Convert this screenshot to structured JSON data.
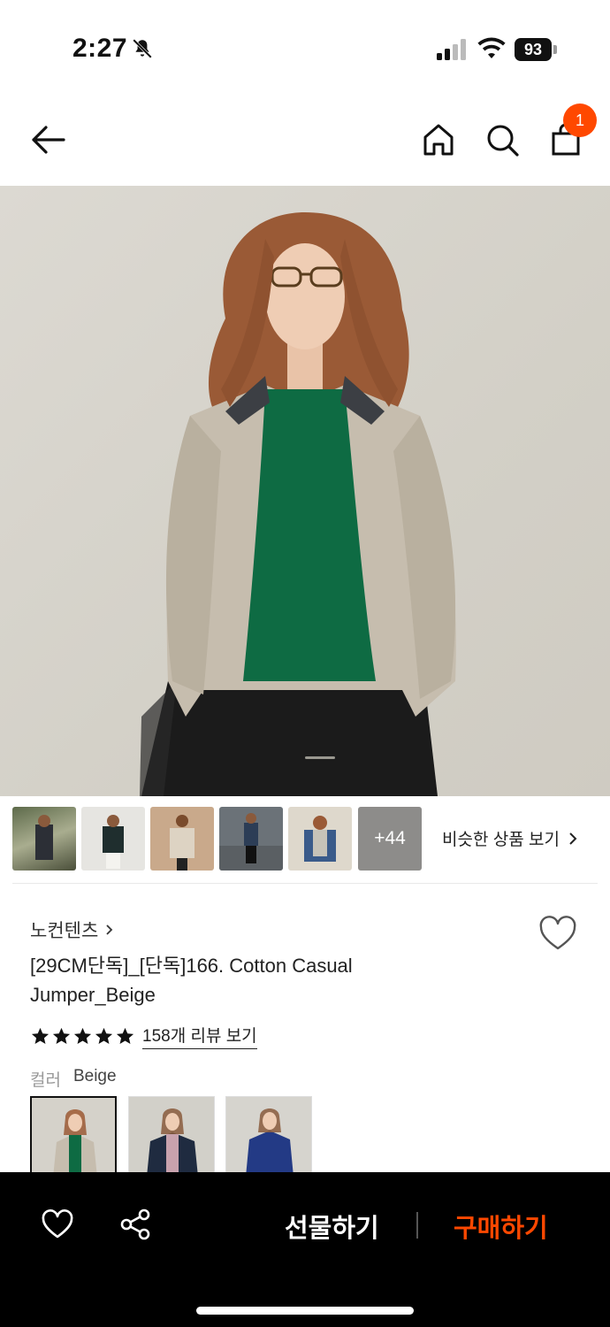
{
  "status_bar": {
    "time": "2:27",
    "battery": "93"
  },
  "header": {
    "cart_count": "1"
  },
  "gallery": {
    "more_count": "+44",
    "similar_label": "비슷한 상품 보기"
  },
  "product": {
    "brand": "노컨텐츠",
    "title": "[29CM단독]_[단독]166. Cotton Casual Jumper_Beige",
    "rating_stars": 5,
    "review_link": "158개 리뷰 보기",
    "color_label": "컬러",
    "color_value": "Beige"
  },
  "bottom_bar": {
    "gift_label": "선물하기",
    "buy_label": "구매하기"
  },
  "colors": {
    "accent": "#ff4800",
    "bottom_bar_bg": "#000000"
  }
}
